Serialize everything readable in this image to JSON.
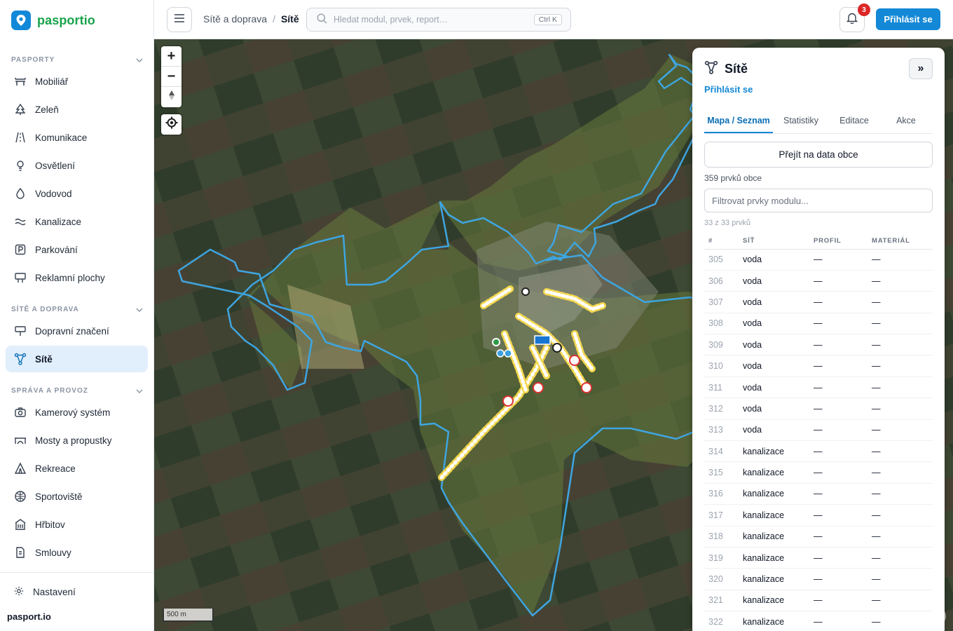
{
  "brand": {
    "name": "pasportio",
    "footer": "pasport.io"
  },
  "sidebar": {
    "sections": [
      {
        "title": "PASPORTY",
        "items": [
          "Mobiliář",
          "Zeleň",
          "Komunikace",
          "Osvětlení",
          "Vodovod",
          "Kanalizace",
          "Parkování",
          "Reklamní plochy"
        ]
      },
      {
        "title": "SÍTĚ A DOPRAVA",
        "items": [
          "Dopravní značení",
          "Sítě"
        ]
      },
      {
        "title": "SPRÁVA A PROVOZ",
        "items": [
          "Kamerový systém",
          "Mosty a propustky",
          "Rekreace",
          "Sportoviště",
          "Hřbitov",
          "Smlouvy"
        ]
      }
    ],
    "active_item": "Sítě",
    "settings": "Nastavení"
  },
  "topbar": {
    "breadcrumb": [
      "Sítě a doprava",
      "Sítě"
    ],
    "search_placeholder": "Hledat modul, prvek, report…",
    "search_shortcut": "Ctrl K",
    "notifications_count": "3",
    "login_label": "Přihlásit se"
  },
  "map": {
    "zoom_in": "+",
    "zoom_out": "−",
    "scale_label": "500 m"
  },
  "panel": {
    "title": "Sítě",
    "collapse_label": "»",
    "login_link": "Přihlásit se",
    "tabs": [
      "Mapa / Seznam",
      "Statistiky",
      "Editace",
      "Akce"
    ],
    "active_tab": "Mapa / Seznam",
    "data_button": "Přejít na data obce",
    "total_count": "359 prvků obce",
    "filter_placeholder": "Filtrovat prvky modulu...",
    "filtered_count": "33 z 33 prvků",
    "columns": [
      "#",
      "SÍŤ",
      "PROFIL",
      "MATERIÁL"
    ],
    "rows": [
      [
        "305",
        "voda",
        "—",
        "—"
      ],
      [
        "306",
        "voda",
        "—",
        "—"
      ],
      [
        "307",
        "voda",
        "—",
        "—"
      ],
      [
        "308",
        "voda",
        "—",
        "—"
      ],
      [
        "309",
        "voda",
        "—",
        "—"
      ],
      [
        "310",
        "voda",
        "—",
        "—"
      ],
      [
        "311",
        "voda",
        "—",
        "—"
      ],
      [
        "312",
        "voda",
        "—",
        "—"
      ],
      [
        "313",
        "voda",
        "—",
        "—"
      ],
      [
        "314",
        "kanalizace",
        "—",
        "—"
      ],
      [
        "315",
        "kanalizace",
        "—",
        "—"
      ],
      [
        "316",
        "kanalizace",
        "—",
        "—"
      ],
      [
        "317",
        "kanalizace",
        "—",
        "—"
      ],
      [
        "318",
        "kanalizace",
        "—",
        "—"
      ],
      [
        "319",
        "kanalizace",
        "—",
        "—"
      ],
      [
        "320",
        "kanalizace",
        "—",
        "—"
      ],
      [
        "321",
        "kanalizace",
        "—",
        "—"
      ],
      [
        "322",
        "kanalizace",
        "—",
        "—"
      ]
    ]
  },
  "colors": {
    "accent": "#1388d6",
    "brand_green": "#17a34a",
    "boundary": "#3ea5e0",
    "active_bg": "#e1eefb"
  }
}
